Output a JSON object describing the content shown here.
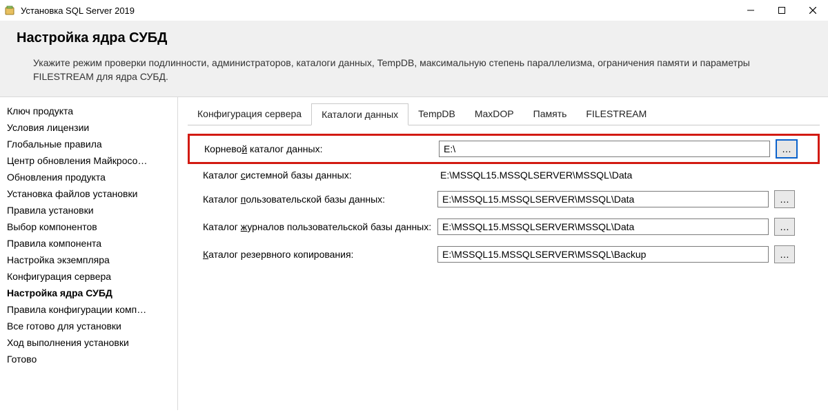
{
  "window": {
    "title": "Установка SQL Server 2019"
  },
  "header": {
    "title": "Настройка ядра СУБД",
    "subtitle": "Укажите режим проверки подлинности, администраторов, каталоги данных, TempDB, максимальную степень параллелизма, ограничения памяти и параметры FILESTREAM для ядра СУБД."
  },
  "sidebar": {
    "items": [
      "Ключ продукта",
      "Условия лицензии",
      "Глобальные правила",
      "Центр обновления Майкросо…",
      "Обновления продукта",
      "Установка файлов установки",
      "Правила установки",
      "Выбор компонентов",
      "Правила компонента",
      "Настройка экземпляра",
      "Конфигурация сервера",
      "Настройка ядра СУБД",
      "Правила конфигурации комп…",
      "Все готово для установки",
      "Ход выполнения установки",
      "Готово"
    ],
    "current_index": 11
  },
  "tabs": {
    "items": [
      "Конфигурация сервера",
      "Каталоги данных",
      "TempDB",
      "MaxDOP",
      "Память",
      "FILESTREAM"
    ],
    "active_index": 1
  },
  "form": {
    "root_dir": {
      "label_pre": "Корнево",
      "label_mn": "й",
      "label_post": " каталог данных:",
      "value": "E:\\"
    },
    "system_db": {
      "label_pre": "Каталог ",
      "label_mn": "с",
      "label_post": "истемной базы данных:",
      "value": "E:\\MSSQL15.MSSQLSERVER\\MSSQL\\Data"
    },
    "user_db": {
      "label_pre": "Каталог ",
      "label_mn": "п",
      "label_post": "ользовательской базы данных:",
      "value": "E:\\MSSQL15.MSSQLSERVER\\MSSQL\\Data"
    },
    "user_log": {
      "label_pre": "Каталог ",
      "label_mn": "ж",
      "label_post": "урналов пользовательской базы данных:",
      "value": "E:\\MSSQL15.MSSQLSERVER\\MSSQL\\Data"
    },
    "backup": {
      "label_pre": "",
      "label_mn": "К",
      "label_post": "аталог резервного копирования:",
      "value": "E:\\MSSQL15.MSSQLSERVER\\MSSQL\\Backup"
    },
    "browse": "…"
  }
}
